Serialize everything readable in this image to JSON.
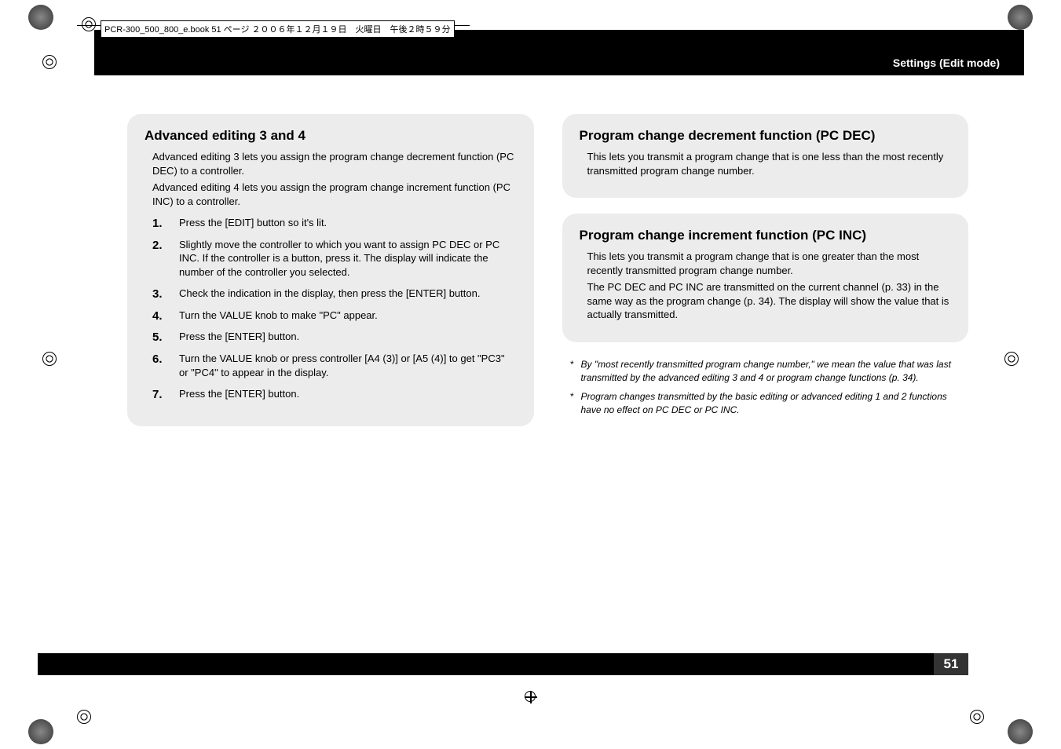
{
  "meta": {
    "file_label": "PCR-300_500_800_e.book  51 ページ  ２００６年１２月１９日　火曜日　午後２時５９分",
    "section_header": "Settings (Edit mode)",
    "page_number": "51"
  },
  "left": {
    "title": "Advanced editing 3 and 4",
    "intro1": "Advanced editing 3 lets you assign the program change decrement function (PC DEC) to a controller.",
    "intro2": "Advanced editing 4 lets you assign the program change increment function (PC INC) to a controller.",
    "steps": [
      "Press the [EDIT] button so it's lit.",
      "Slightly move the controller to which you want to assign PC DEC or PC INC. If the controller is a button, press it.\nThe display will indicate the number of the controller you selected.",
      "Check the indication in the display, then press the [ENTER] button.",
      "Turn the VALUE knob to make \"PC\" appear.",
      "Press the [ENTER] button.",
      "Turn the VALUE knob or press controller [A4 (3)] or [A5 (4)] to get \"PC3\" or \"PC4\" to appear in the display.",
      "Press the [ENTER] button."
    ]
  },
  "right": {
    "dec": {
      "title": "Program change decrement function (PC DEC)",
      "body": "This lets you transmit a program change that is one less than the most recently transmitted program change number."
    },
    "inc": {
      "title": "Program change increment function (PC INC)",
      "body1": "This lets you transmit a program change that is one greater than the most recently transmitted program change number.",
      "body2": "The PC DEC and PC INC are transmitted on the current channel (p. 33) in the same way as the program change (p. 34). The display will show the value that is actually transmitted."
    },
    "notes": [
      "By \"most recently transmitted program change number,\" we mean the value that was last transmitted by the advanced editing 3 and 4 or program change functions (p. 34).",
      "Program changes transmitted by the basic editing or advanced editing 1 and 2 functions have no effect on PC DEC or PC INC."
    ]
  }
}
